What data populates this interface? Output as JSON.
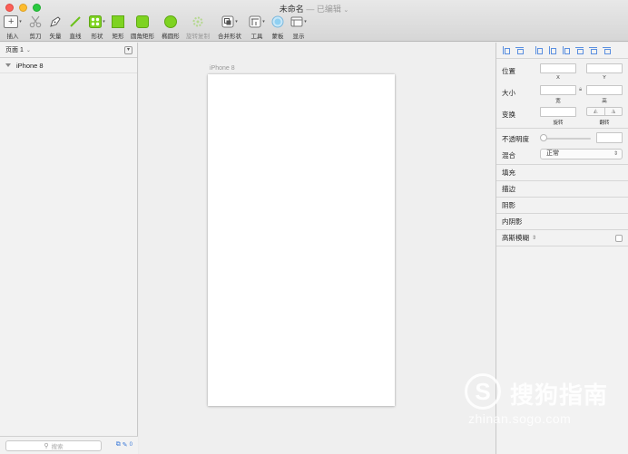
{
  "window": {
    "title": "未命名",
    "edited": "— 已编辑",
    "title_chevron": "chevron-down-icon"
  },
  "toolbar": [
    {
      "id": "insert",
      "label": "插入",
      "icon": "plus-box-icon",
      "dim": false
    },
    {
      "id": "scissors",
      "label": "剪刀",
      "icon": "scissors-icon",
      "dim": false
    },
    {
      "id": "vector",
      "label": "矢量",
      "icon": "pen-icon",
      "dim": false
    },
    {
      "id": "line",
      "label": "直线",
      "icon": "line-icon",
      "dim": false
    },
    {
      "id": "shape",
      "label": "形状",
      "icon": "shapes-icon",
      "dim": false
    },
    {
      "id": "rect",
      "label": "矩形",
      "icon": "rectangle-icon",
      "dim": false
    },
    {
      "id": "roundrect",
      "label": "圆角矩形",
      "icon": "rounded-rectangle-icon",
      "dim": false
    },
    {
      "id": "oval",
      "label": "椭圆形",
      "icon": "oval-icon",
      "dim": false
    },
    {
      "id": "rotatecopy",
      "label": "旋转复制",
      "icon": "rotate-copy-icon",
      "dim": true
    },
    {
      "id": "combine",
      "label": "合并形状",
      "icon": "combine-shapes-icon",
      "dim": false
    },
    {
      "id": "tools",
      "label": "工具",
      "icon": "tools-icon",
      "dim": false
    },
    {
      "id": "mask",
      "label": "蒙板",
      "icon": "mask-icon",
      "dim": false
    },
    {
      "id": "view",
      "label": "显示",
      "icon": "view-icon",
      "dim": false
    }
  ],
  "sidebar": {
    "page_selector": "页面 1",
    "layers": [
      {
        "name": "iPhone 8"
      }
    ],
    "search_placeholder": "搜索",
    "filter_count": "0"
  },
  "canvas": {
    "artboard_name": "iPhone 8"
  },
  "inspector": {
    "position": {
      "label": "位置",
      "x_label": "X",
      "y_label": "Y",
      "x": "",
      "y": ""
    },
    "size": {
      "label": "大小",
      "w_label": "宽",
      "h_label": "高",
      "w": "",
      "h": ""
    },
    "transform": {
      "label": "变换",
      "rotate_label": "旋转",
      "flip_label": "翻转"
    },
    "opacity": {
      "label": "不透明度",
      "value": ""
    },
    "blend": {
      "label": "混合",
      "value": "正常"
    },
    "sections": [
      "填充",
      "描边",
      "阴影",
      "内阴影"
    ],
    "blur_label": "高斯模糊"
  },
  "watermark": {
    "brand": "搜狗指南",
    "url": "zhinan.sogo.com"
  },
  "colors": {
    "accent": "#3b7ad9",
    "shape_green": "#7ed321",
    "close": "#fc5f57",
    "minimize": "#fdbc2e",
    "zoom": "#29c940"
  }
}
